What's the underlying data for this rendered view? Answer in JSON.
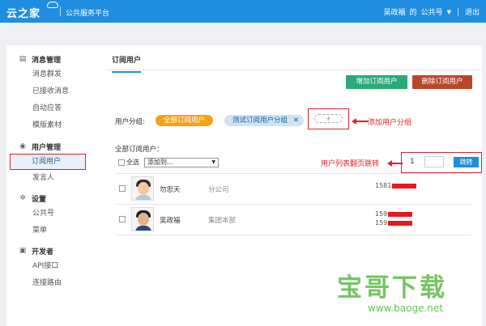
{
  "header": {
    "logo": "云之家",
    "subtitle": "公共服务平台",
    "user": "吴政福",
    "of": "的",
    "account": "公共号",
    "logout": "退出"
  },
  "sidebar": {
    "groups": [
      {
        "title": "消息管理",
        "icon": "message-icon",
        "items": [
          "消息群发",
          "已接收消息",
          "自动应答",
          "模版素材"
        ]
      },
      {
        "title": "用户管理",
        "icon": "user-icon",
        "items": [
          "订阅用户",
          "发言人"
        ]
      },
      {
        "title": "设置",
        "icon": "gear-icon",
        "items": [
          "公共号",
          "菜单"
        ]
      },
      {
        "title": "开发者",
        "icon": "cube-icon",
        "items": [
          "API接口",
          "连接路由"
        ]
      }
    ],
    "active": "订阅用户"
  },
  "main": {
    "tab": "订阅用户",
    "add_button": "增加订阅用户",
    "delete_button": "删除订阅用户",
    "group_label": "用户分组:",
    "groups": [
      "全部订阅用户",
      "测试订阅用户分组"
    ],
    "add_group_placeholder": "+",
    "add_group_annotation": "添加用户分组",
    "list_title": "全部订阅用户：",
    "select_all": "全选",
    "add_to_select": "添加到...",
    "page_annotation": "用户列表翻页跳转",
    "page_number": "1",
    "jump_button": "跳转",
    "users": [
      {
        "name": "勿忠天",
        "dept": "分公司",
        "phones": [
          "1581"
        ]
      },
      {
        "name": "吴政福",
        "dept": "集团本部",
        "phones": [
          "159",
          "159"
        ]
      }
    ]
  },
  "watermark": {
    "text": "宝哥下载",
    "url": "www.baoge.net"
  },
  "colors": {
    "header": "#1f8ee0",
    "add_button": "#2aaa7a",
    "delete_button": "#b9472a",
    "group_all": "#f5a21b",
    "annotation": "#d9262b"
  }
}
